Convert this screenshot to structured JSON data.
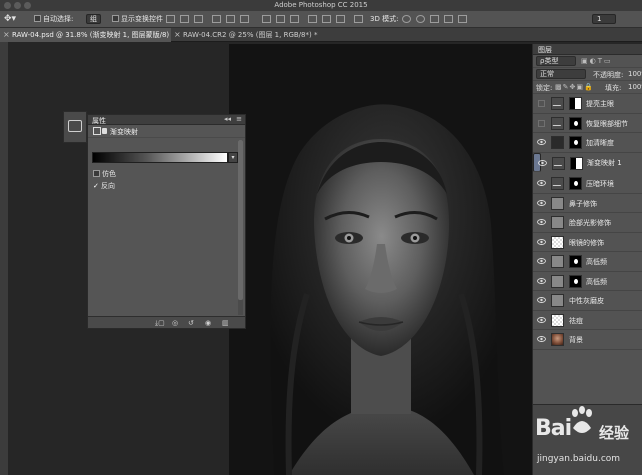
{
  "app": {
    "title": "Adobe Photoshop CC 2015"
  },
  "options_bar": {
    "auto_select_label": "自动选择:",
    "auto_select_value": "组",
    "show_transform_label": "显示变换控件",
    "mode_3d_label": "3D 模式:",
    "workspace_value": "1"
  },
  "tabs": [
    {
      "label": "RAW-04.psd @ 31.8% (渐变映射 1, 图层蒙版/8) *",
      "active": true
    },
    {
      "label": "RAW-04.CR2 @ 25% (图层 1, RGB/8*) *",
      "active": false
    }
  ],
  "properties": {
    "title": "属性",
    "panel_type": "渐变映射",
    "dither_label": "仿色",
    "dither_checked": false,
    "reverse_label": "反向",
    "reverse_checked": true
  },
  "layers_panel": {
    "title": "图层",
    "filter_value": "ρ类型",
    "blend_mode": "正常",
    "opacity_label": "不透明度:",
    "opacity_value": "100%",
    "lock_label": "锁定:",
    "fill_label": "填充:",
    "fill_value": "100%",
    "layers": [
      {
        "name": "提亮主眼",
        "visible": false,
        "kind": "adjustment",
        "mask": true,
        "selected": false
      },
      {
        "name": "恢复眼部细节",
        "visible": false,
        "kind": "adjustment",
        "mask": true,
        "selected": false
      },
      {
        "name": "加清晰度",
        "visible": true,
        "kind": "pixel-dark",
        "mask": true,
        "selected": false
      },
      {
        "name": "渐变映射 1",
        "visible": true,
        "kind": "adjustment",
        "mask": true,
        "selected": true
      },
      {
        "name": "压暗环境",
        "visible": true,
        "kind": "adjustment",
        "mask": true,
        "selected": false
      },
      {
        "name": "鼻子修饰",
        "visible": true,
        "kind": "gray",
        "mask": false,
        "selected": false
      },
      {
        "name": "脸部光影修饰",
        "visible": true,
        "kind": "gray",
        "mask": false,
        "selected": false
      },
      {
        "name": "眼镜的修饰",
        "visible": true,
        "kind": "checker",
        "mask": false,
        "selected": false
      },
      {
        "name": "高低频",
        "visible": true,
        "kind": "gray",
        "mask": true,
        "selected": false
      },
      {
        "name": "高低频",
        "visible": true,
        "kind": "gray",
        "mask": true,
        "selected": false
      },
      {
        "name": "中性灰磨皮",
        "visible": true,
        "kind": "gray",
        "mask": false,
        "selected": false
      },
      {
        "name": "祛痘",
        "visible": true,
        "kind": "checker",
        "mask": false,
        "selected": false
      },
      {
        "name": "背景",
        "visible": true,
        "kind": "photo",
        "mask": false,
        "selected": false
      }
    ]
  },
  "watermark": {
    "brand_latin": "Bai",
    "brand_tail": "经验",
    "url": "jingyan.baidu.com"
  },
  "colors": {
    "chrome_dark": "#3b3b3b",
    "panel": "#535353",
    "selection": "#6b7892",
    "canvas_bg": "#262626"
  }
}
